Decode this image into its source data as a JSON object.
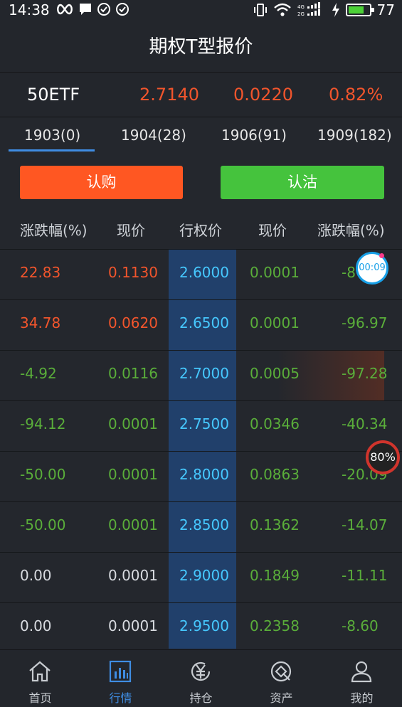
{
  "status_bar": {
    "time": "14:38",
    "battery": "77",
    "battery_level": 0.77
  },
  "header": {
    "title": "期权T型报价"
  },
  "quote": {
    "name": "50ETF",
    "price": "2.7140",
    "change": "0.0220",
    "change_pct": "0.82%"
  },
  "tabs": [
    {
      "label": "1903(0)",
      "active": true
    },
    {
      "label": "1904(28)"
    },
    {
      "label": "1906(91)"
    },
    {
      "label": "1909(182)"
    }
  ],
  "buttons": {
    "call": "认购",
    "put": "认沽"
  },
  "columns": [
    "涨跌幅(%)",
    "现价",
    "行权价",
    "现价",
    "涨跌幅(%)"
  ],
  "rows": [
    {
      "call_pct": "22.83",
      "call_price": "0.1130",
      "strike": "2.6000",
      "put_price": "0.0001",
      "put_pct": "-8",
      "call_color": "red"
    },
    {
      "call_pct": "34.78",
      "call_price": "0.0620",
      "strike": "2.6500",
      "put_price": "0.0001",
      "put_pct": "-96.97",
      "call_color": "red"
    },
    {
      "call_pct": "-4.92",
      "call_price": "0.0116",
      "strike": "2.7000",
      "put_price": "0.0005",
      "put_pct": "-97.28",
      "call_color": "green"
    },
    {
      "call_pct": "-94.12",
      "call_price": "0.0001",
      "strike": "2.7500",
      "put_price": "0.0346",
      "put_pct": "-40.34",
      "call_color": "green"
    },
    {
      "call_pct": "-50.00",
      "call_price": "0.0001",
      "strike": "2.8000",
      "put_price": "0.0863",
      "put_pct": "-20.09",
      "call_color": "green"
    },
    {
      "call_pct": "-50.00",
      "call_price": "0.0001",
      "strike": "2.8500",
      "put_price": "0.1362",
      "put_pct": "-14.07",
      "call_color": "green"
    },
    {
      "call_pct": "0.00",
      "call_price": "0.0001",
      "strike": "2.9000",
      "put_price": "0.1849",
      "put_pct": "-11.11",
      "call_color": "gray"
    },
    {
      "call_pct": "0.00",
      "call_price": "0.0001",
      "strike": "2.9500",
      "put_price": "0.2358",
      "put_pct": "-8.60",
      "call_color": "gray"
    }
  ],
  "overlays": {
    "timer": "00:09",
    "progress": "80%"
  },
  "bottom_nav": [
    {
      "label": "首页",
      "icon": "home-icon"
    },
    {
      "label": "行情",
      "icon": "market-chart-icon",
      "active": true
    },
    {
      "label": "持仓",
      "icon": "holdings-yen-icon"
    },
    {
      "label": "资产",
      "icon": "assets-icon"
    },
    {
      "label": "我的",
      "icon": "profile-icon"
    }
  ],
  "colors": {
    "up": "#f2552c",
    "down": "#5aae3a",
    "strike": "#46c8ff",
    "accent": "#3f8de3"
  }
}
